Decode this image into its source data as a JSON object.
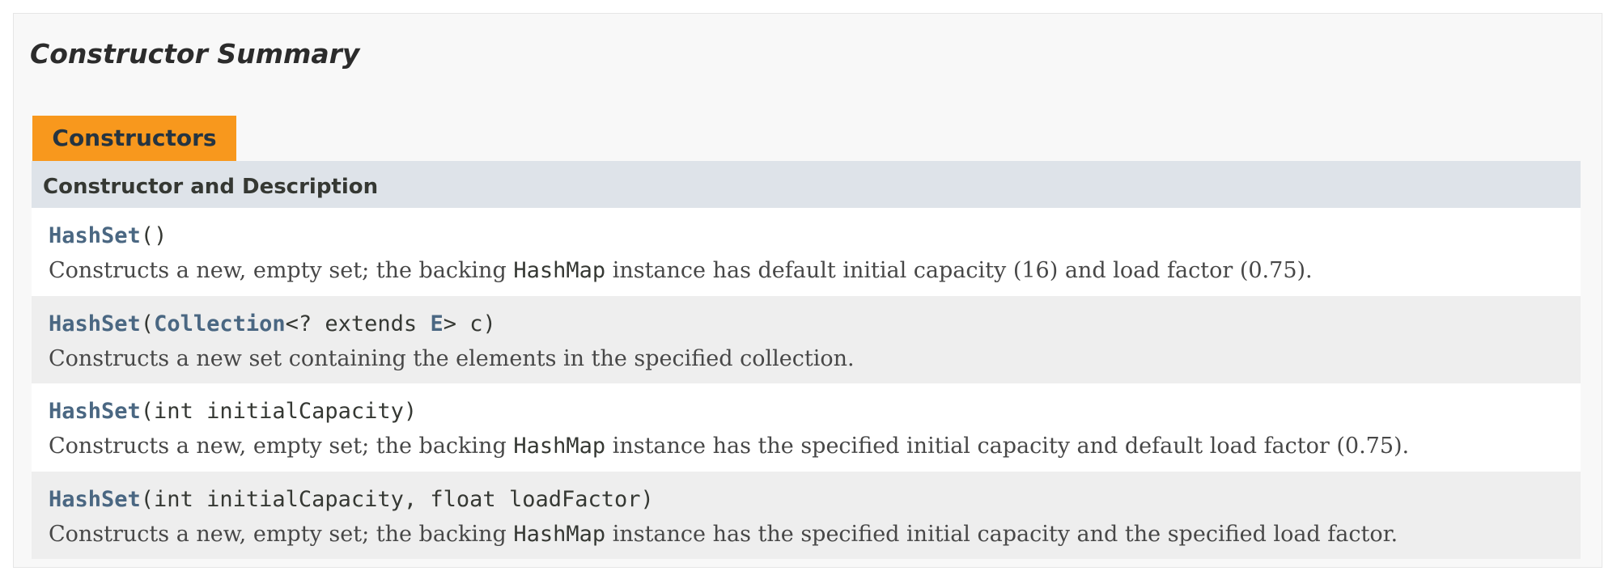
{
  "summary": {
    "title": "Constructor Summary",
    "caption": "Constructors",
    "column_header": "Constructor and Description"
  },
  "constructors": [
    {
      "name": "HashSet",
      "params_open": "(",
      "params_close": ")",
      "desc_before": "Constructs a new, empty set; the backing ",
      "desc_code": "HashMap",
      "desc_after": " instance has default initial capacity (16) and load factor (0.75)."
    },
    {
      "name": "HashSet",
      "params_open": "(",
      "param_type": "Collection",
      "param_mid": "<? extends ",
      "param_generic": "E",
      "params_close": "> c)",
      "description": "Constructs a new set containing the elements in the specified collection."
    },
    {
      "name": "HashSet",
      "params_close": "(int initialCapacity)",
      "desc_before": "Constructs a new, empty set; the backing ",
      "desc_code": "HashMap",
      "desc_after": " instance has the specified initial capacity and default load factor (0.75)."
    },
    {
      "name": "HashSet",
      "params_close": "(int initialCapacity, float loadFactor)",
      "desc_before": "Constructs a new, empty set; the backing ",
      "desc_code": "HashMap",
      "desc_after": " instance has the specified initial capacity and the specified load factor."
    }
  ],
  "colors": {
    "caption_background": "#f8981d",
    "header_background": "#dee3e9",
    "link": "#4a6782",
    "row_alt": "#eeeeee"
  }
}
